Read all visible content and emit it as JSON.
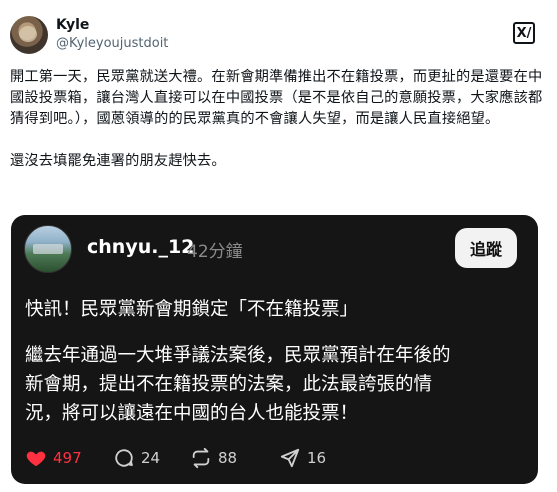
{
  "author": {
    "name": "Kyle",
    "handle": "@Kyleyoujustdoit"
  },
  "brand": {
    "logo_text": "X/"
  },
  "post": {
    "text": "開工第一天，民眾黨就送大禮。在新會期準備推出不在籍投票，而更扯的是還要在中國設投票箱，讓台灣人直接可以在中國投票（是不是依自己的意願投票，大家應該都猜得到吧。），國蒽領導的的民眾黨真的不會讓人失望，而是讓人民直接絕望。\n\n還沒去填罷免連署的朋友趕快去。"
  },
  "card": {
    "author_name": "chnyu._12",
    "time": "42分鐘",
    "follow_label": "追蹤",
    "headline": "快訊！民眾黨新會期鎖定「不在籍投票」",
    "body": "繼去年通過一大堆爭議法案後，民眾黨預計在年後的\n新會期，提出不在籍投票的法案，此法最誇張的情\n況，將可以讓遠在中國的台人也能投票！",
    "likes": "497",
    "replies": "24",
    "reposts": "88",
    "shares": "16",
    "like_color": "#ff3040"
  }
}
